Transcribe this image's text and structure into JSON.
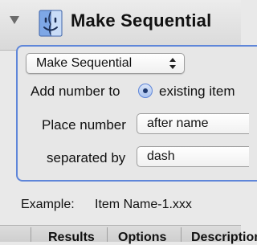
{
  "action": {
    "title": "Make Sequential",
    "icon": "finder-icon"
  },
  "form": {
    "mode_popup": "Make Sequential",
    "add_number_label": "Add number to",
    "add_number_option": "existing item",
    "place_number_label": "Place number",
    "place_number_value": "after name",
    "separated_by_label": "separated by",
    "separated_by_value": "dash"
  },
  "example": {
    "label": "Example:",
    "value": "Item Name-1.xxx"
  },
  "tabs": [
    "Results",
    "Options",
    "Description"
  ],
  "colors": {
    "selection_border": "#5f86d9",
    "background": "#e9e9e9"
  }
}
